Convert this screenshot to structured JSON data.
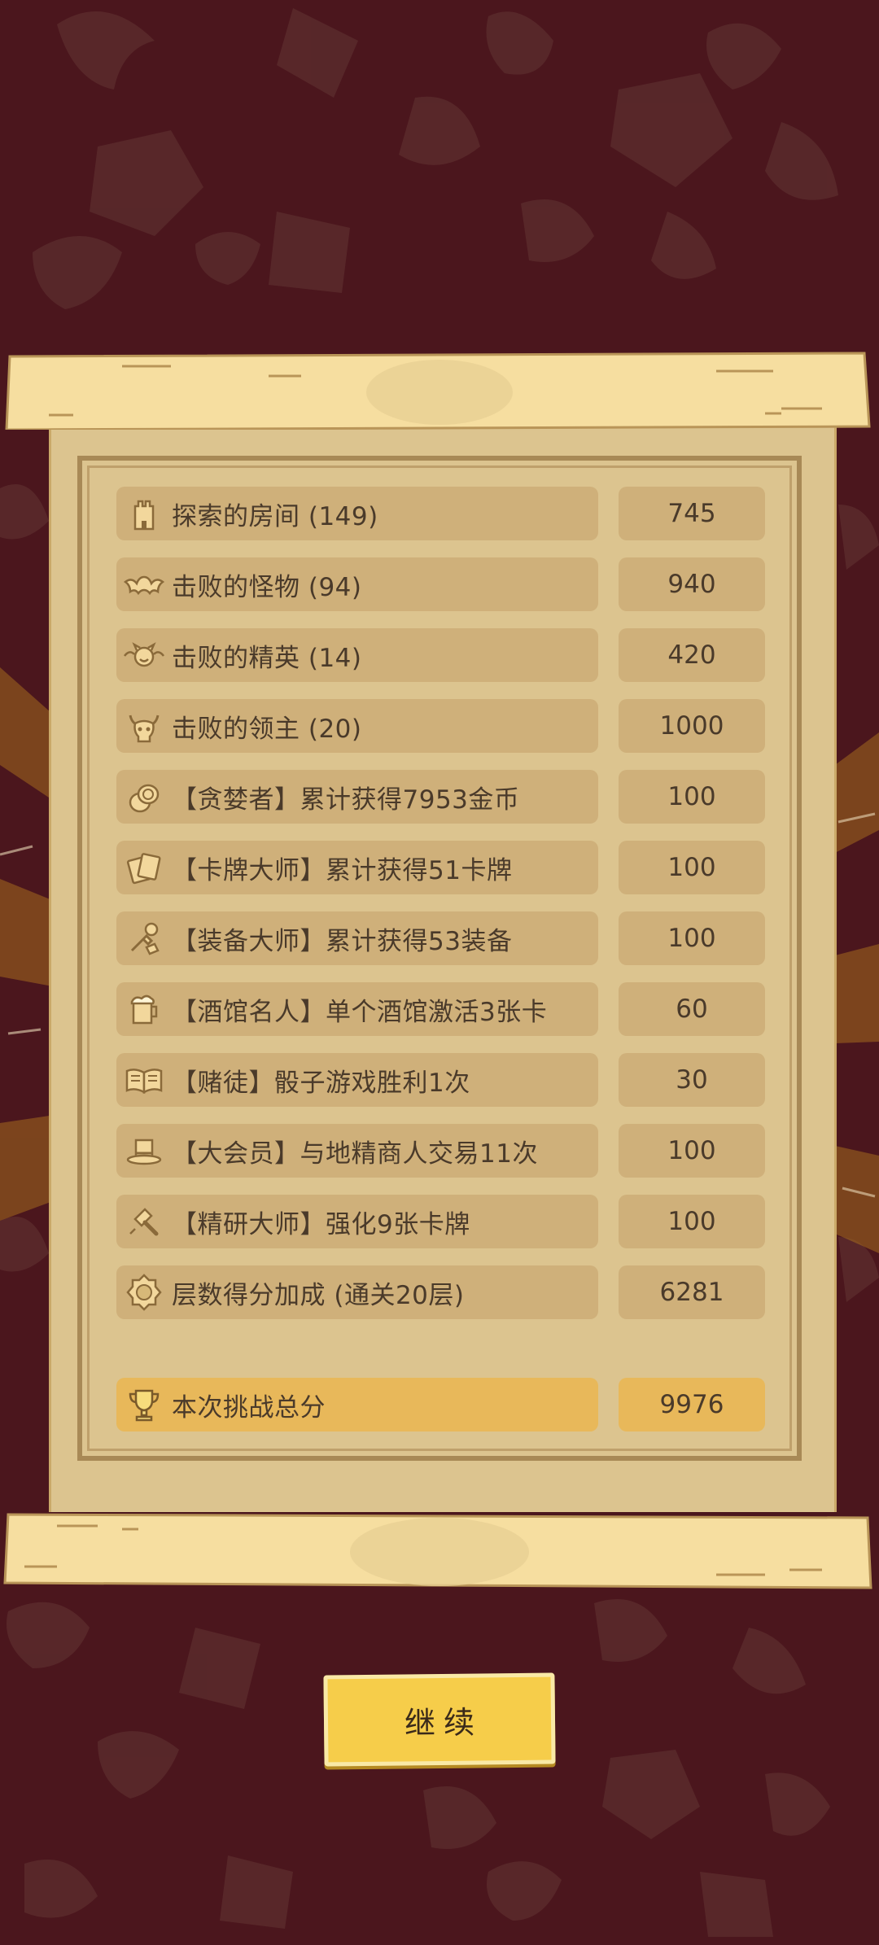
{
  "scoreboard": {
    "rows": [
      {
        "icon": "tower-icon",
        "label": "探索的房间 (149)",
        "value": "745"
      },
      {
        "icon": "bat-icon",
        "label": "击败的怪物 (94)",
        "value": "940"
      },
      {
        "icon": "winged-demon-icon",
        "label": "击败的精英 (14)",
        "value": "420"
      },
      {
        "icon": "horned-skull-icon",
        "label": "击败的领主 (20)",
        "value": "1000"
      },
      {
        "icon": "coins-icon",
        "label": "【贪婪者】累计获得7953金币",
        "value": "100"
      },
      {
        "icon": "cards-icon",
        "label": "【卡牌大师】累计获得51卡牌",
        "value": "100"
      },
      {
        "icon": "equipment-icon",
        "label": "【装备大师】累计获得53装备",
        "value": "100"
      },
      {
        "icon": "beer-mug-icon",
        "label": "【酒馆名人】单个酒馆激活3张卡",
        "value": "60"
      },
      {
        "icon": "open-book-icon",
        "label": "【赌徒】骰子游戏胜利1次",
        "value": "30"
      },
      {
        "icon": "top-hat-icon",
        "label": "【大会员】与地精商人交易11次",
        "value": "100"
      },
      {
        "icon": "hammer-icon",
        "label": "【精研大师】强化9张卡牌",
        "value": "100"
      },
      {
        "icon": "floor-badge-icon",
        "label": "层数得分加成 (通关20层)",
        "value": "6281"
      }
    ],
    "total": {
      "icon": "trophy-icon",
      "label": "本次挑战总分",
      "value": "9976"
    }
  },
  "continue_button": {
    "label": "继续"
  },
  "colors": {
    "background": "#4b161d",
    "paper": "#dcc48f",
    "row_box": "#cfb07a",
    "total_box": "#e8b85a",
    "button": "#f6cd4a"
  }
}
